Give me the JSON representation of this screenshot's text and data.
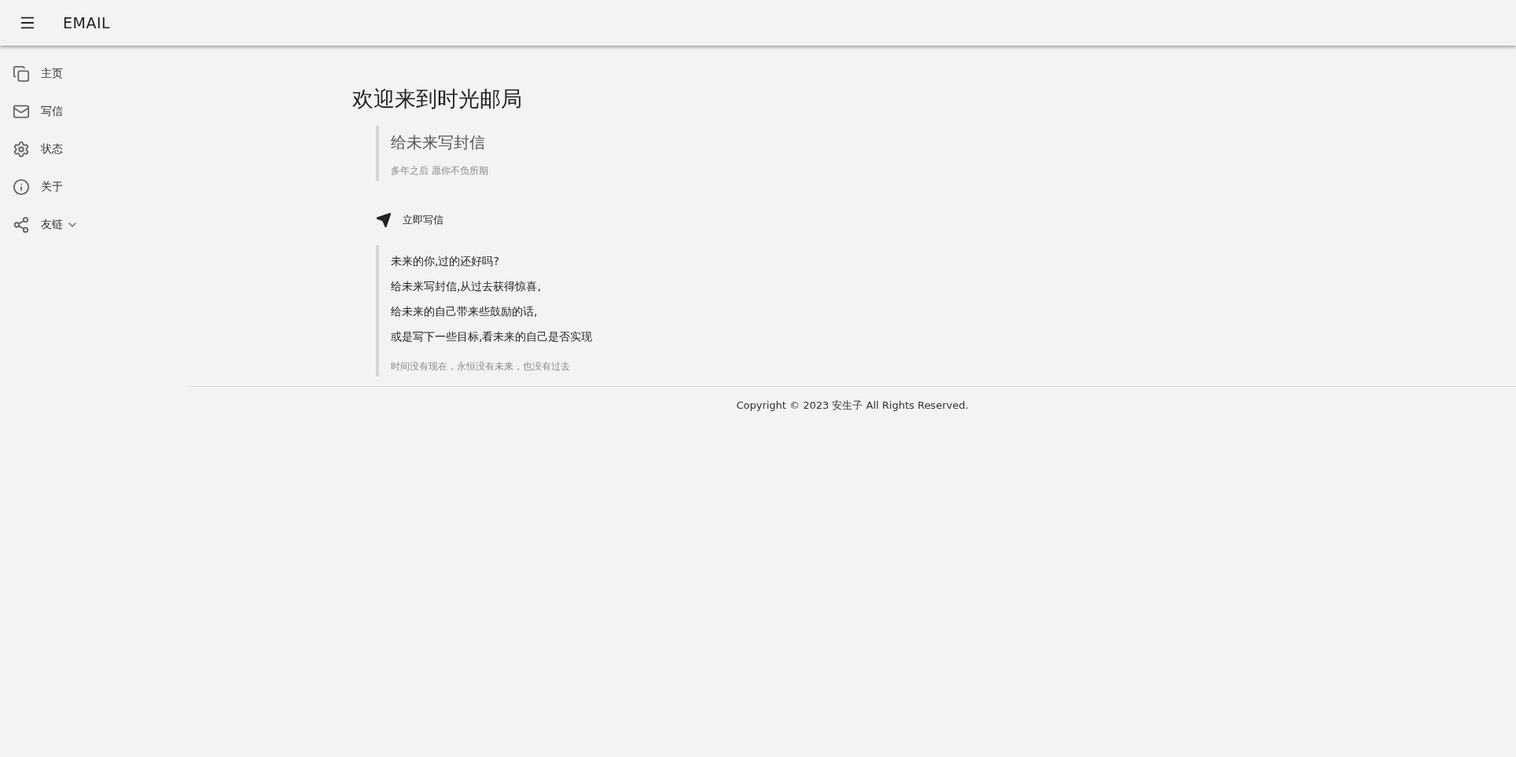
{
  "header": {
    "title": "EMAIL"
  },
  "sidebar": {
    "items": [
      {
        "label": "主页"
      },
      {
        "label": "写信"
      },
      {
        "label": "状态"
      },
      {
        "label": "关于"
      },
      {
        "label": "友链",
        "expandable": true
      }
    ]
  },
  "main": {
    "title": "欢迎来到时光邮局",
    "intro": {
      "heading": "给未来写封信",
      "subheading": "多年之后 愿你不负所期"
    },
    "write_button": "立即写信",
    "quote": {
      "lines": [
        "未来的你,过的还好吗?",
        "给未来写封信,从过去获得惊喜,",
        "给未来的自己带来些鼓励的话,",
        "或是写下一些目标,看未来的自己是否实现"
      ],
      "footer": "时间没有现在，永恒没有未来，也没有过去"
    }
  },
  "footer": {
    "copyright": "Copyright © 2023 安生子 All Rights Reserved."
  }
}
